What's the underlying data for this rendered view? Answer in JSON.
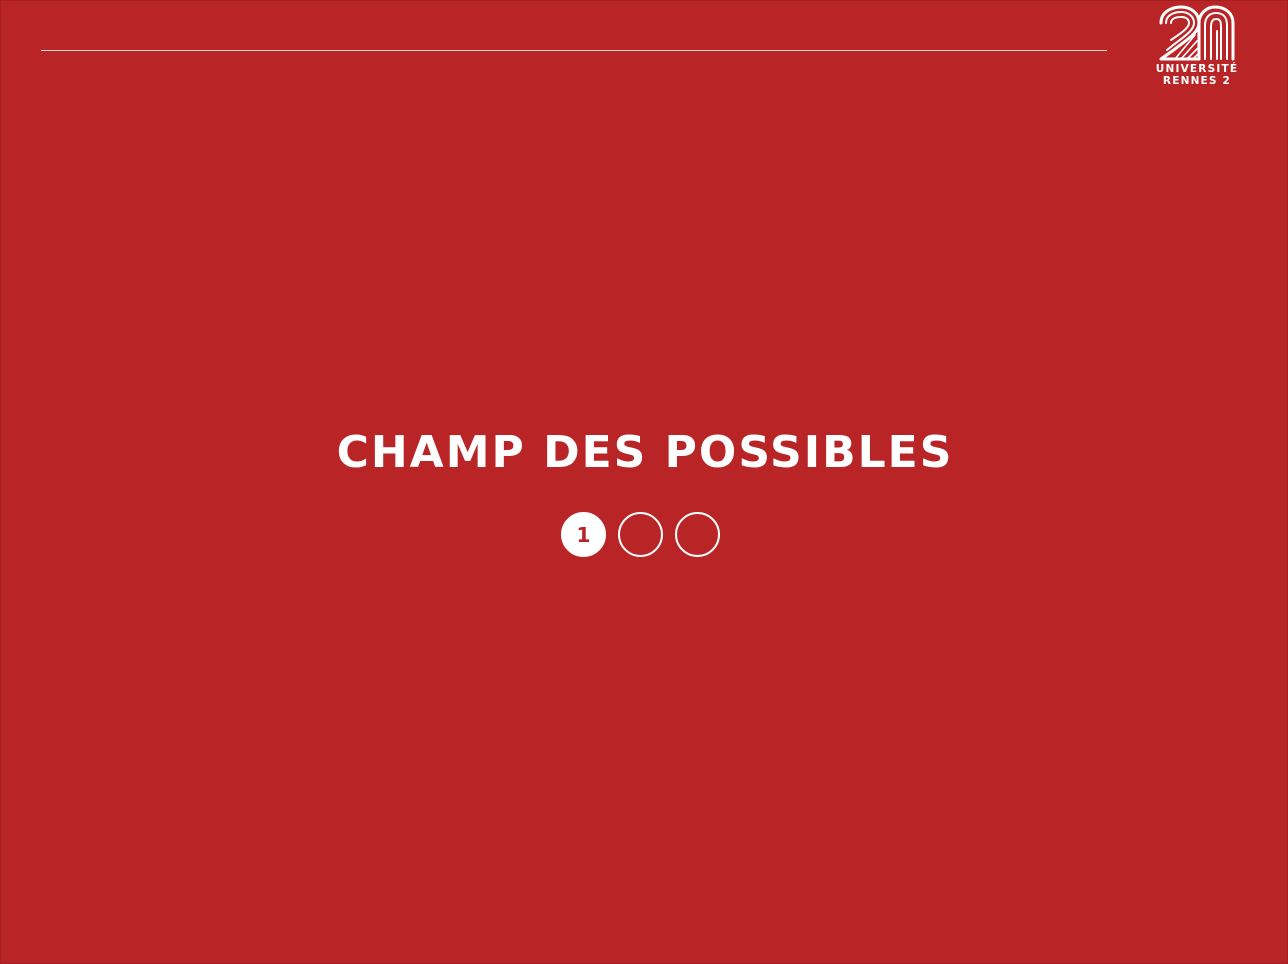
{
  "slide": {
    "title": "CHAMP DES POSSIBLES"
  },
  "logo": {
    "line1": "UNIVERSITÉ",
    "line2": "RENNES 2"
  },
  "steps": [
    {
      "label": "1",
      "active": true
    },
    {
      "label": "",
      "active": false
    },
    {
      "label": "",
      "active": false
    }
  ],
  "colors": {
    "background": "#b92526",
    "foreground": "#ffffff"
  }
}
